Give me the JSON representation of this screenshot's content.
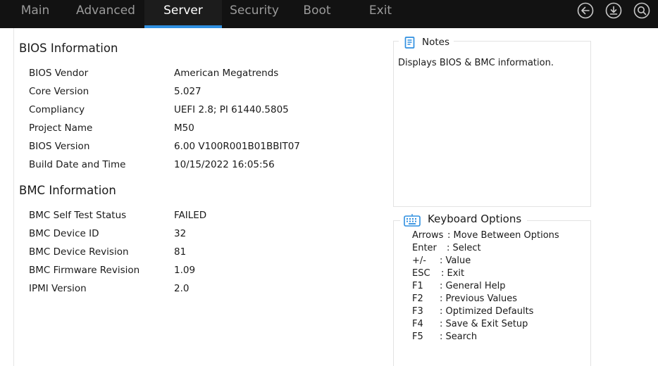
{
  "tabs": [
    {
      "label": "Main"
    },
    {
      "label": "Advanced"
    },
    {
      "label": "Server",
      "active": true
    },
    {
      "label": "Security"
    },
    {
      "label": "Boot"
    },
    {
      "label": "Exit"
    }
  ],
  "top_icons": [
    "back-arrow-icon",
    "download-icon",
    "search-icon"
  ],
  "bios_section": {
    "title": "BIOS Information",
    "rows": [
      {
        "label": "BIOS Vendor",
        "value": "American Megatrends"
      },
      {
        "label": "Core Version",
        "value": "5.027"
      },
      {
        "label": "Compliancy",
        "value": "UEFI 2.8; PI 61440.5805"
      },
      {
        "label": "Project Name",
        "value": "M50"
      },
      {
        "label": "BIOS Version",
        "value": "6.00 V100R001B01BBIT07"
      },
      {
        "label": "Build Date and Time",
        "value": "10/15/2022 16:05:56"
      }
    ]
  },
  "bmc_section": {
    "title": "BMC Information",
    "rows": [
      {
        "label": "BMC Self Test Status",
        "value": "FAILED"
      },
      {
        "label": "BMC Device ID",
        "value": "32"
      },
      {
        "label": "BMC Device Revision",
        "value": "81"
      },
      {
        "label": "BMC Firmware Revision",
        "value": "1.09"
      },
      {
        "label": "IPMI Version",
        "value": "2.0"
      }
    ]
  },
  "notes": {
    "title": "Notes",
    "text": "Displays BIOS & BMC information.",
    "icon": "notes-icon"
  },
  "keyboard": {
    "title": "Keyboard Options",
    "icon": "keyboard-icon",
    "items": [
      {
        "key": "Arrows",
        "desc": ": Move Between Options"
      },
      {
        "key": "Enter",
        "desc": ": Select"
      },
      {
        "key": "+/-",
        "desc": ": Value"
      },
      {
        "key": "ESC",
        "desc": ": Exit"
      },
      {
        "key": "F1",
        "desc": ": General Help"
      },
      {
        "key": "F2",
        "desc": ": Previous Values"
      },
      {
        "key": "F3",
        "desc": ": Optimized Defaults"
      },
      {
        "key": "F4",
        "desc": ": Save & Exit Setup"
      },
      {
        "key": "F5",
        "desc": ": Search"
      }
    ]
  },
  "colors": {
    "topbar": "#121212",
    "active_tab_underline": "#2f8fe0",
    "icon_blue": "#2f8fe0"
  }
}
